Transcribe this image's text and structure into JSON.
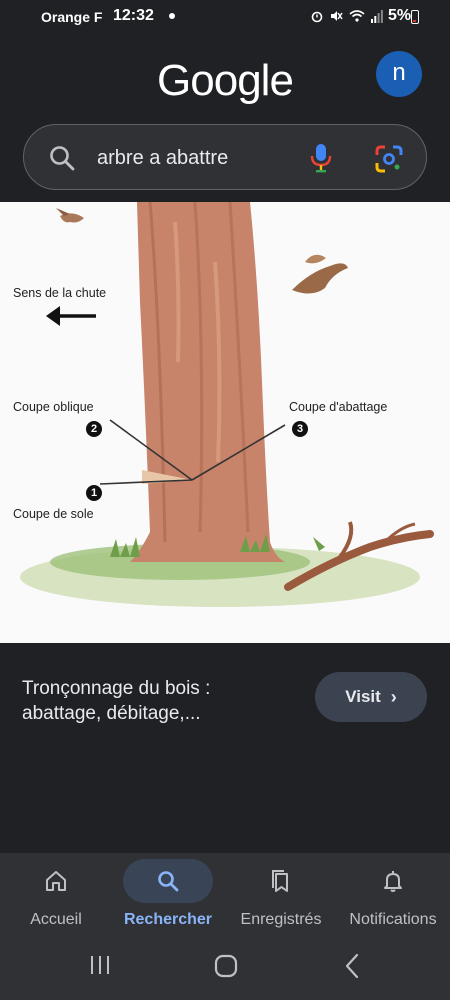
{
  "status_bar": {
    "carrier": "Orange F",
    "time": "12:32",
    "battery": "5%",
    "icons": [
      "alarm-icon",
      "mute-icon",
      "wifi-icon",
      "signal-icon",
      "battery-icon"
    ]
  },
  "header": {
    "logo": "Google",
    "avatar_initial": "n",
    "avatar_color": "#1a5fb4"
  },
  "search": {
    "query": "arbre a abattre"
  },
  "image": {
    "labels": {
      "fall_direction": "Sens de la chute",
      "oblique_cut": "Coupe oblique",
      "felling_cut": "Coupe d'abattage",
      "sole_cut": "Coupe de sole"
    },
    "badges": [
      "1",
      "2",
      "3"
    ]
  },
  "result": {
    "title": "Tronçonnage du bois : abattage, débitage,...",
    "visit_label": "Visit"
  },
  "bottom_nav": {
    "items": [
      {
        "label": "Accueil",
        "icon": "home-icon",
        "active": false
      },
      {
        "label": "Rechercher",
        "icon": "search-icon",
        "active": true
      },
      {
        "label": "Enregistrés",
        "icon": "bookmarks-icon",
        "active": false
      },
      {
        "label": "Notifications",
        "icon": "bell-icon",
        "active": false
      }
    ],
    "active_color": "#8ab4f8"
  }
}
